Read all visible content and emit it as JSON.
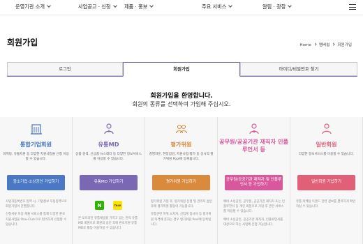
{
  "nav": {
    "items": [
      "운영기관 소개",
      "사업공고 · 신청",
      "제품 · 홍보",
      "주요 서비스",
      "알림 · 광장"
    ]
  },
  "page": {
    "title": "회원가입",
    "breadcrumb": [
      "Home",
      "멤버쉽",
      "회원가입"
    ]
  },
  "tabs": [
    "로그인",
    "회원가입",
    "아이디/비밀번호 찾기"
  ],
  "welcome": {
    "title": "회원가입을 환영합니다.",
    "subtitle": "회원의 종류를 선택하여 가입해 주십시오."
  },
  "colors": {
    "blue": "#4a78c4",
    "purple": "#7b68b5",
    "orange": "#d98a3d",
    "pink": "#d9579c",
    "rose": "#e25f78"
  },
  "cards": [
    {
      "icon": "building-icon",
      "title": "통합기업회원",
      "desc": "마케팅, 유통지원 등 다양한 지원사업을 신청 이용할 수 있습니다.",
      "button": "중소기업·소상공인 가입하기",
      "body": [
        "사업자등록번호 입력 시, 기업정보 자동입력으로 회원가입이 간편합니다.",
        "신청서류 저장 제출 서비스를 통해 다양한 판로지원사업을 One-Click으로 편리하게 신청할 수 있습니다."
      ]
    },
    {
      "icon": "person-icon",
      "title": "유통MD",
      "desc": "상품 검색, 신상품 뉴스레터 등 다양한 정보서비스를 이용할 수 있습니다.",
      "button": "유통MD 가입하기",
      "social": [
        "N",
        "TALK"
      ],
      "body": [
        "온·오프라인 유통채널을 가지고 있는 현직 유통MD 회원으로 회원의 승인 후에 판로지원 유통MD로 활동 이용하실 수 있습니다."
      ]
    },
    {
      "icon": "evaluator-icon",
      "title": "평가위원",
      "desc": "경영자문, 현장점검, 지원사업 평가 등 상시적 평가위원 Pool에 등록됩니다.",
      "button": "평가위원 가입하기",
      "body": [
        "평가위원 가입 후, 평가위원 신청 및 관리자 승인 후에 평가위원 활동이 가능합니다.",
        "유통관련 학위 소지자, 산업계 종사자 등 평가위원 자격에 준하는 경우 평가위원 Pool에 등록됩니다."
      ]
    },
    {
      "icon": "staff-icon",
      "title": "공무원/공공기관 재직자 인플루언서 등",
      "desc": "",
      "button": "공무원/공공기관 재직자 및 인플루언서 등 가입하기",
      "body": [
        "예비 소상공인, 공무원, 공공기관 재직자 또는 인플루언서 등 개인 회원으로 가입 후 관련 서비스를 이용할 수 있습니다.",
        "예비 소상공인, 공공기관 재직자, 인플루언서를 대상으로 하는 사업에 신청 가능합니다."
      ]
    },
    {
      "icon": "user-icon",
      "title": "일반회원",
      "desc": "다양한 정보서비스를 이용할 수 있습니다.",
      "button": "일반회원 가입하기",
      "body": [
        "유통·마케팅 트렌드 관련 정보를 편리하게 확인하실 수 있습니다."
      ]
    }
  ]
}
